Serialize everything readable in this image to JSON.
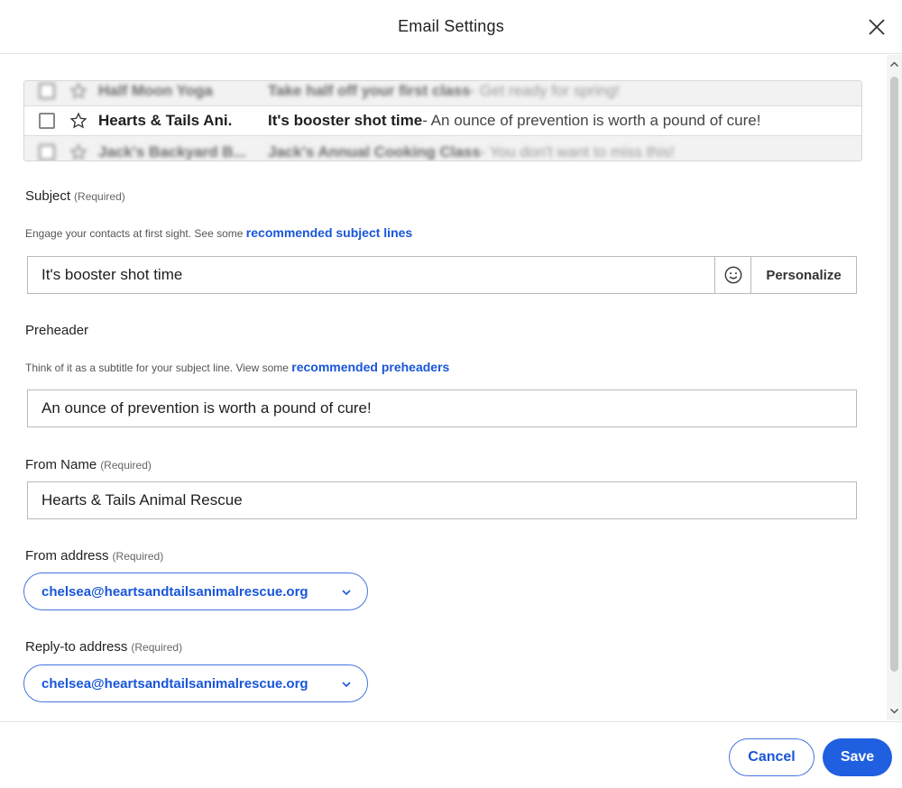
{
  "dialog": {
    "title": "Email Settings"
  },
  "inbox_preview": {
    "rows": [
      {
        "sender": "Half Moon Yoga",
        "subject": "Take half off your first class",
        "preheader": " - Get ready for spring!",
        "state": "blurred"
      },
      {
        "sender": "Hearts & Tails Ani.",
        "subject": "It's booster shot time",
        "preheader": " - An ounce of prevention is worth a pound of cure!",
        "state": "active"
      },
      {
        "sender": "Jack's Backyard B...",
        "subject": "Jack's Annual Cooking Class",
        "preheader": " - You don't want to miss this!",
        "state": "blurred"
      }
    ]
  },
  "subject": {
    "label": "Subject",
    "required": "(Required)",
    "help": "Engage your contacts at first sight. See some ",
    "help_link": "recommended subject lines",
    "value": "It's booster shot time",
    "personalize_label": "Personalize"
  },
  "preheader": {
    "label": "Preheader",
    "help": "Think of it as a subtitle for your subject line. View some ",
    "help_link": "recommended preheaders",
    "value": "An ounce of prevention is worth a pound of cure!"
  },
  "from_name": {
    "label": "From Name",
    "required": "(Required)",
    "value": "Hearts & Tails Animal Rescue"
  },
  "from_address": {
    "label": "From address",
    "required": "(Required)",
    "value": "chelsea@heartsandtailsanimalrescue.org"
  },
  "reply_to": {
    "label": "Reply-to address",
    "required": "(Required)",
    "value": "chelsea@heartsandtailsanimalrescue.org"
  },
  "footer": {
    "cancel_label": "Cancel",
    "save_label": "Save"
  },
  "colors": {
    "accent": "#1856d8",
    "save_button": "#1f5fe0"
  }
}
